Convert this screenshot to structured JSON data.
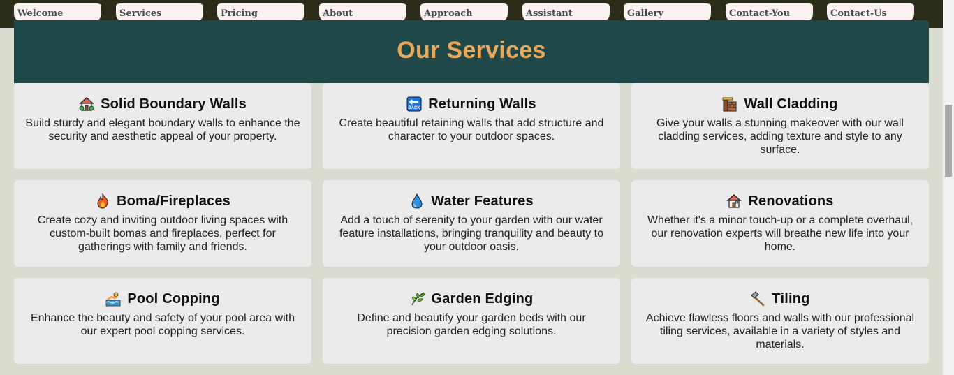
{
  "nav": {
    "items": [
      {
        "label": "Welcome"
      },
      {
        "label": "Services"
      },
      {
        "label": "Pricing"
      },
      {
        "label": "About"
      },
      {
        "label": "Approach"
      },
      {
        "label": "Assistant"
      },
      {
        "label": "Gallery"
      },
      {
        "label": "Contact-You"
      },
      {
        "label": "Contact-Us"
      }
    ]
  },
  "services": {
    "title": "Our Services",
    "cards": [
      {
        "title": "Solid Boundary Walls",
        "icon": "house-garden-icon",
        "description": "Build sturdy and elegant boundary walls to enhance the security and aesthetic appeal of your property."
      },
      {
        "title": "Returning Walls",
        "icon": "back-arrow-icon",
        "description": "Create beautiful retaining walls that add structure and character to your outdoor spaces."
      },
      {
        "title": "Wall Cladding",
        "icon": "bricks-icon",
        "description": "Give your walls a stunning makeover with our wall cladding services, adding texture and style to any surface."
      },
      {
        "title": "Boma/Fireplaces",
        "icon": "fire-icon",
        "description": "Create cozy and inviting outdoor living spaces with custom-built bomas and fireplaces, perfect for gatherings with family and friends."
      },
      {
        "title": "Water Features",
        "icon": "droplet-icon",
        "description": "Add a touch of serenity to your garden with our water feature installations, bringing tranquility and beauty to your outdoor oasis."
      },
      {
        "title": "Renovations",
        "icon": "house-icon",
        "description": "Whether it's a minor touch-up or a complete overhaul, our renovation experts will breathe new life into your home."
      },
      {
        "title": "Pool Copping",
        "icon": "swimmer-icon",
        "description": "Enhance the beauty and safety of your pool area with our expert pool copping services."
      },
      {
        "title": "Garden Edging",
        "icon": "herb-leaf-icon",
        "description": "Define and beautify your garden beds with our precision garden edging solutions."
      },
      {
        "title": "Tiling",
        "icon": "hammer-icon",
        "description": "Achieve flawless floors and walls with our professional tiling services, available in a variety of styles and materials."
      }
    ]
  },
  "colors": {
    "page_bg": "#d9ddd0",
    "nav_bg": "#2b2c1a",
    "header_bg": "#214849",
    "title_color": "#e9a85a",
    "card_bg": "#ebebeb"
  }
}
